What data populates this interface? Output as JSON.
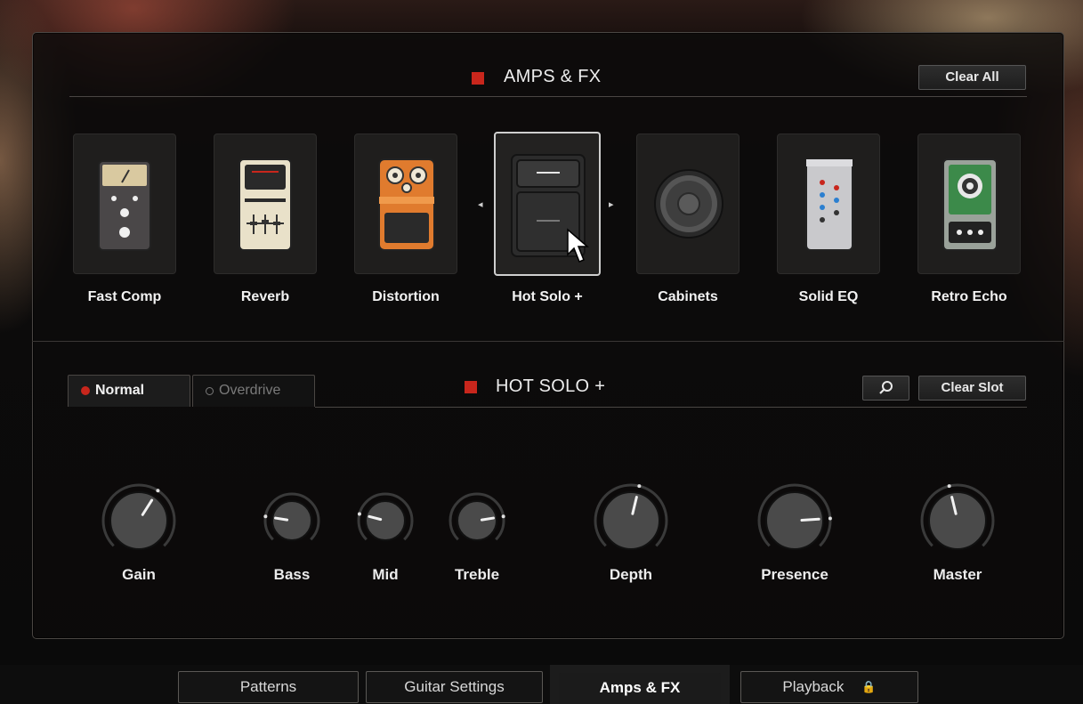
{
  "amps_fx": {
    "title": "AMPS & FX",
    "clear_all_label": "Clear All",
    "slots": [
      {
        "label": "Fast Comp",
        "icon": "compressor-pedal-icon"
      },
      {
        "label": "Reverb",
        "icon": "reverb-pedal-icon"
      },
      {
        "label": "Distortion",
        "icon": "distortion-pedal-icon"
      },
      {
        "label": "Hot Solo +",
        "icon": "amp-icon",
        "selected": true
      },
      {
        "label": "Cabinets",
        "icon": "speaker-cabinet-icon"
      },
      {
        "label": "Solid EQ",
        "icon": "eq-pedal-icon"
      },
      {
        "label": "Retro Echo",
        "icon": "echo-pedal-icon"
      }
    ]
  },
  "module": {
    "title": "HOT SOLO +",
    "tabs": [
      {
        "label": "Normal",
        "active": true
      },
      {
        "label": "Overdrive",
        "active": false
      }
    ],
    "clear_slot_label": "Clear Slot",
    "search_icon": "magnifier-icon",
    "knobs": [
      {
        "label": "Gain",
        "value": 0.62
      },
      {
        "label": "Bass",
        "value": 0.2
      },
      {
        "label": "Mid",
        "value": 0.22
      },
      {
        "label": "Treble",
        "value": 0.8
      },
      {
        "label": "Depth",
        "value": 0.55
      },
      {
        "label": "Presence",
        "value": 0.82
      },
      {
        "label": "Master",
        "value": 0.45
      }
    ]
  },
  "nav": {
    "tabs": [
      {
        "label": "Patterns"
      },
      {
        "label": "Guitar Settings"
      },
      {
        "label": "Amps & FX",
        "active": true
      },
      {
        "label": "Playback",
        "locked": true
      }
    ]
  },
  "colors": {
    "accent_red": "#c8261c",
    "panel_border": "#4a4643"
  }
}
